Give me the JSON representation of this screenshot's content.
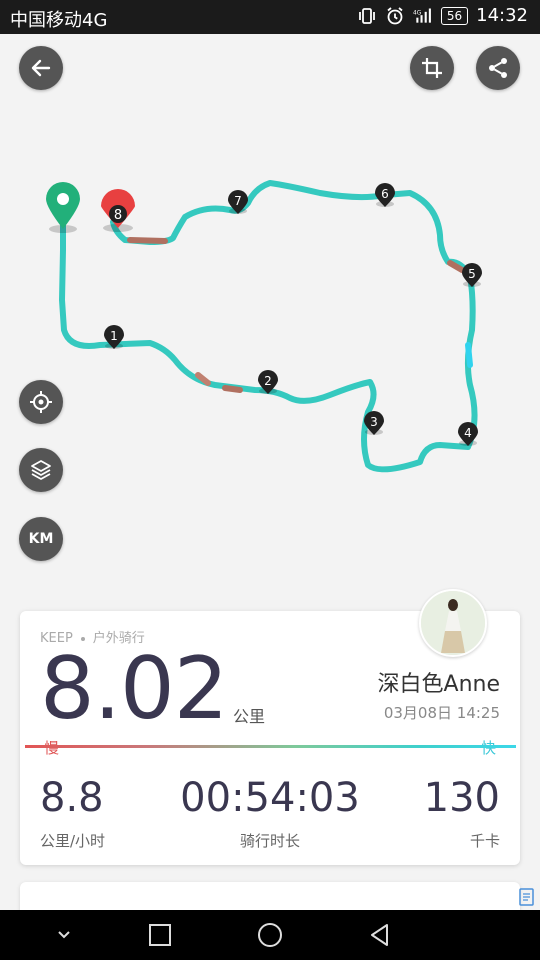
{
  "status_bar": {
    "carrier": "中国移动4G",
    "battery": "56",
    "time": "14:32",
    "icons": [
      "vibrate-icon",
      "alarm-icon",
      "signal-4g-icon",
      "battery-icon"
    ]
  },
  "map_controls": {
    "back": "back-arrow-icon",
    "crop": "crop-icon",
    "share": "share-icon",
    "locate": "locate-icon",
    "layers": "layers-icon",
    "km_label": "KM"
  },
  "route": {
    "start_marker_color": "#22b07a",
    "end_marker_color": "#e84040",
    "end_marker_label": "8",
    "km_markers": [
      "1",
      "2",
      "3",
      "4",
      "5",
      "6",
      "7"
    ],
    "track_color": "#35c9bf",
    "slow_color": "#b07060"
  },
  "summary": {
    "source": "KEEP",
    "activity": "户外骑行",
    "distance": "8.02",
    "distance_unit": "公里",
    "username": "深白色Anne",
    "datetime": "03月08日 14:25",
    "slow_label": "慢",
    "fast_label": "快",
    "stats": [
      {
        "value": "8.8",
        "label": "公里/小时"
      },
      {
        "value": "00:54:03",
        "label": "骑行时长"
      },
      {
        "value": "130",
        "label": "千卡"
      }
    ]
  },
  "nav_bar": {
    "buttons": [
      "chevron-down-icon",
      "recent-apps-icon",
      "home-icon",
      "back-icon"
    ]
  }
}
